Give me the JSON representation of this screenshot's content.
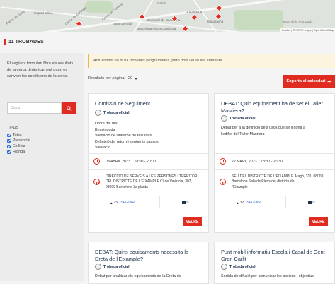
{
  "map": {
    "labels": [
      "Carrer de Sants",
      "Hospital Clínic",
      "Carrer de Còrsega",
      "Carrer de Còrsega",
      "Gràcia",
      "Urquinaona",
      "Eixample de Barcelona",
      "Urquinaona",
      "Barcelona Plaça Catalunya",
      "Parc de la Ciutadella",
      "Sant Gervasi"
    ],
    "attribution": "Leaflet | © HERE maps | OpenStreetMap"
  },
  "results": {
    "count_label": "11 TROBADES"
  },
  "sidebar": {
    "intro": "El següent formulari filtra els resultats de la cerca dinàmicament quan es canvien les condicions de la cerca.",
    "search_placeholder": "Cerca",
    "type_title": "TIPUS",
    "types": [
      {
        "label": "Totes",
        "checked": true
      },
      {
        "label": "Presencial",
        "checked": true
      },
      {
        "label": "En línia",
        "checked": true
      },
      {
        "label": "Híbrida",
        "checked": true
      }
    ]
  },
  "notice": {
    "text": "Actualment no hi ha trobades programades, però pots veure les anteriors."
  },
  "controls": {
    "per_page_label": "Resultats per pàgina:",
    "per_page_value": "20",
    "export_label": "Exporta el calendari",
    "export_icon": "share-arrow-icon"
  },
  "colors": {
    "accent": "#e02b20",
    "title": "#1a2f4a",
    "notice_bg": "#fcf4df",
    "check": "#2f6fd0"
  },
  "cards": [
    {
      "title": "Comissió de Seguiment",
      "badge": "Trobada oficial",
      "description": [
        "Ordre del dia:",
        "Benvinguda",
        "Validació de l'informe de resultats",
        "Definició del retorn i següents passos",
        "Valoració..."
      ],
      "date": "03 ABRIL 2023",
      "time": "18:00 - 20:00",
      "address": [
        "DIRECCIÓ DE SERVEIS A LES PERSONES I TERRITORI",
        "DEL DISTRICTE DE L'EIXAMPLE C/ de València, 307,",
        "08009 Barcelona 3a planta"
      ],
      "follow_count": "25",
      "follow_label": "SEGUIR",
      "comments": "0",
      "button": "VEURE"
    },
    {
      "title": "DEBAT: Quin equipament ha de ser el Taller Masriera?",
      "badge": "Trobada oficial",
      "description": [
        "Debat per a la definició dels usos que se li dona a",
        "l'edifici del Taller Masriera"
      ],
      "date": "22 MARÇ 2023",
      "time": "18:30 - 20:30",
      "address": [
        "SEU DEL DISTRICTE DE L'EIXAMPLE Aragó, 311, 08009",
        "Barcelona Sala de Plens del districte de",
        "l'Eixample"
      ],
      "follow_count": "32",
      "follow_label": "SEGUIR",
      "comments": "0",
      "button": "VEURE"
    },
    {
      "title": "DEBAT: Quins equipaments necessita la Dreta de l'Eixample?",
      "badge": "Trobada oficial",
      "description": [
        "Debat per analitzar els equipaments de la Dreta de"
      ]
    },
    {
      "title": "Punt mòbil informatiu Escola i Casal de Gent Gran Carlit",
      "badge": "Trobada oficial",
      "description": [
        "Sortida de difusió per comunicar les accions i objectius"
      ]
    }
  ]
}
